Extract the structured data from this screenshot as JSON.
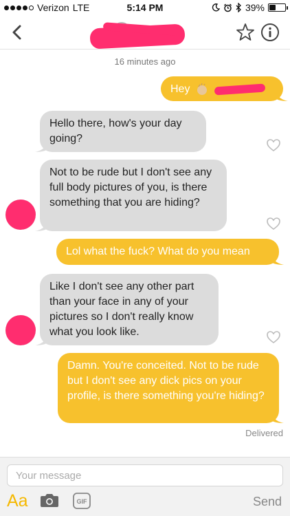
{
  "status_bar": {
    "carrier": "Verizon",
    "network": "LTE",
    "time": "5:14 PM",
    "battery_percent": "39%",
    "battery_level": 0.39,
    "signal_bars_filled": 4,
    "signal_bars_total": 5
  },
  "nav": {
    "back_icon": "chevron-left-icon",
    "star_icon": "star-outline-icon",
    "info_icon": "info-circle-icon"
  },
  "conversation": {
    "timestamp": "16 minutes ago",
    "messages": [
      {
        "side": "sent",
        "text": "Hey"
      },
      {
        "side": "received",
        "text": "Hello there, how's your day going?"
      },
      {
        "side": "received",
        "text": "Not to be rude but I don't see any full body pictures of you, is there something that you are hiding?"
      },
      {
        "side": "sent",
        "text": "Lol what the fuck? What do you mean"
      },
      {
        "side": "received",
        "text": "Like I don't see any other part than your face in any of your pictures so I don't really know what you look like."
      },
      {
        "side": "sent",
        "text": "Damn. You're conceited. Not to be rude but I don't see any dick pics on your profile, is there something you're hiding?"
      }
    ],
    "delivered_label": "Delivered"
  },
  "composer": {
    "placeholder": "Your message",
    "aa_label": "Aa",
    "gif_label": "GIF",
    "send_label": "Send"
  },
  "colors": {
    "sent_bubble": "#f7c12d",
    "received_bubble": "#dcdcdc",
    "accent": "#f5b800",
    "redaction": "#ff2d6f"
  }
}
